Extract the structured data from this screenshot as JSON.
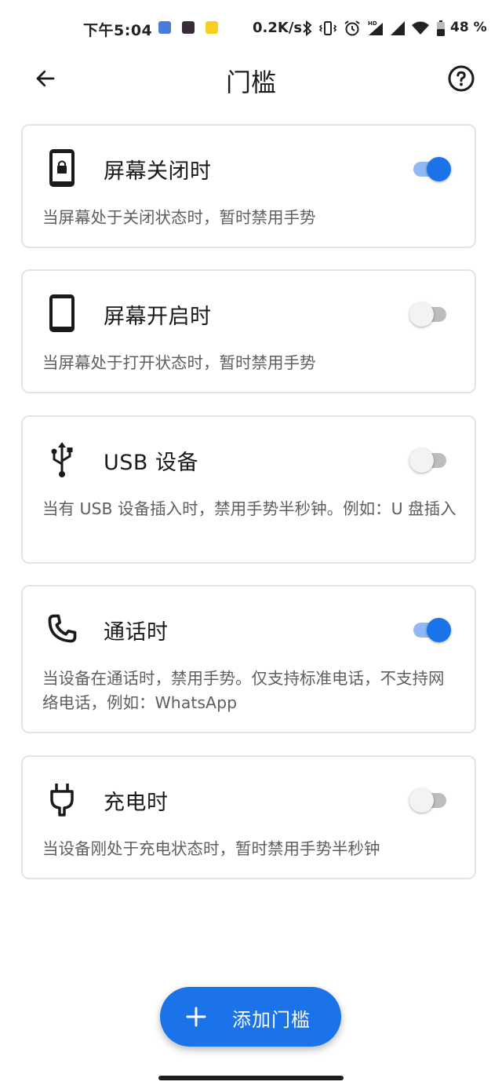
{
  "status_bar": {
    "time": "下午5:04",
    "speed": "0.2K/s",
    "battery_text": "48 %",
    "icons": [
      "app-notify-blue-icon",
      "app-notify-red-icon",
      "app-notify-yellow-icon",
      "bluetooth-icon",
      "vibrate-icon",
      "alarm-icon",
      "hd-signal-icon",
      "signal-icon",
      "wifi-icon",
      "battery-icon"
    ]
  },
  "app_bar": {
    "title": "门槛",
    "back_icon": "arrow-back-icon",
    "help_icon": "help-circle-icon"
  },
  "cards": [
    {
      "icon": "lock-phone-icon",
      "title": "屏幕关闭时",
      "description": "当屏幕处于关闭状态时，暂时禁用手势",
      "enabled": true
    },
    {
      "icon": "phone-icon",
      "title": "屏幕开启时",
      "description": "当屏幕处于打开状态时，暂时禁用手势",
      "enabled": false
    },
    {
      "icon": "usb-icon",
      "title": "USB 设备",
      "description": "当有 USB 设备插入时，禁用手势半秒钟。例如：U 盘插入",
      "enabled": false
    },
    {
      "icon": "call-icon",
      "title": "通话时",
      "description": "当设备在通话时，禁用手势。仅支持标准电话，不支持网络电话，例如：WhatsApp",
      "enabled": true
    },
    {
      "icon": "power-plug-icon",
      "title": "充电时",
      "description": "当设备刚处于充电状态时，暂时禁用手势半秒钟",
      "enabled": false
    }
  ],
  "fab": {
    "label": "添加门槛",
    "icon": "plus-icon"
  },
  "colors": {
    "accent": "#1a73e8",
    "accent_track": "#8fb8f4",
    "card_border": "#e4e4e4",
    "desc_text": "#5f5f5f"
  }
}
